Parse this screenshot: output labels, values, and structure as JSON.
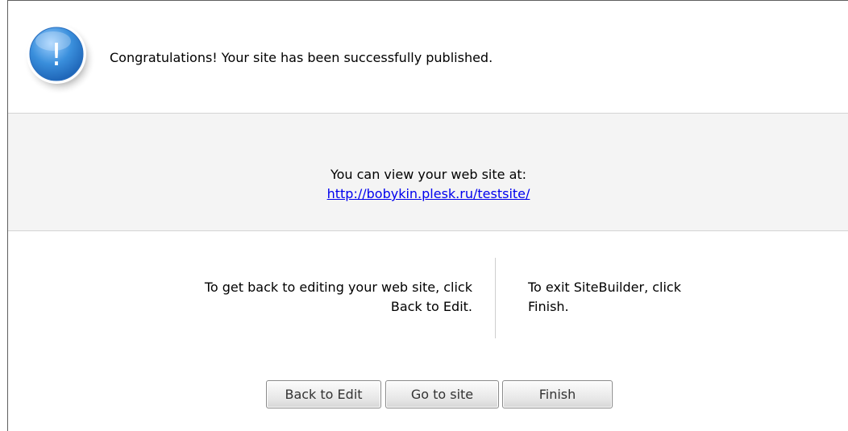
{
  "header": {
    "message": "Congratulations! Your site has been successfully published.",
    "icon": "info-icon",
    "icon_symbol": "!"
  },
  "view_section": {
    "text": "You can view your web site at:",
    "link": "http://bobykin.plesk.ru/testsite/"
  },
  "hints": {
    "back_line1": "To get back to editing your web site, click",
    "back_line2": "Back to Edit.",
    "exit_line1": "To exit SiteBuilder, click",
    "exit_line2": "Finish."
  },
  "buttons": {
    "back_to_edit": "Back to Edit",
    "go_to_site": "Go to site",
    "finish": "Finish"
  },
  "colors": {
    "link": "#0000ee",
    "icon_blue": "#3a8fdc",
    "band_bg": "#f4f4f4"
  }
}
